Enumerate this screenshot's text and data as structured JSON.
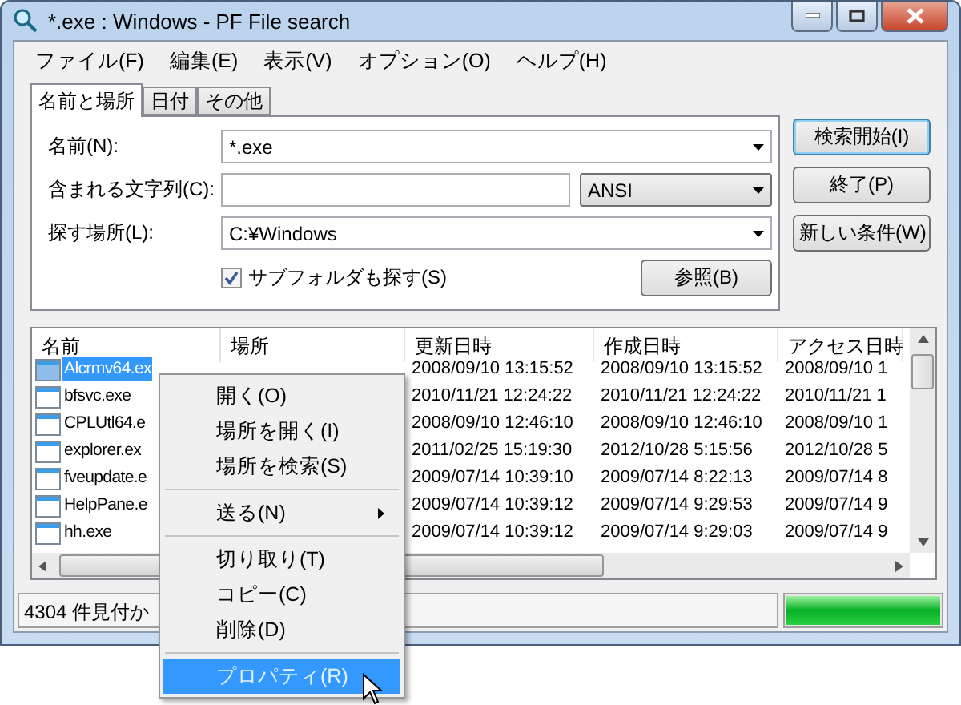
{
  "window": {
    "title": "*.exe : Windows - PF File search"
  },
  "menu": [
    "ファイル(F)",
    "編集(E)",
    "表示(V)",
    "オプション(O)",
    "ヘルプ(H)"
  ],
  "tabs": [
    {
      "label": "名前と場所",
      "selected": true
    },
    {
      "label": "日付",
      "selected": false
    },
    {
      "label": "その他",
      "selected": false
    }
  ],
  "form": {
    "name_label": "名前(N):",
    "name_value": "*.exe",
    "contains_label": "含まれる文字列(C):",
    "encoding": "ANSI",
    "location_label": "探す場所(L):",
    "location_value": "C:¥Windows",
    "subfolders": {
      "label": "サブフォルダも探す(S)",
      "checked": true
    },
    "browse_button": "参照(B)"
  },
  "buttons": [
    "検索開始(I)",
    "終了(P)",
    "新しい条件(W)"
  ],
  "table": {
    "columns": [
      "名前",
      "場所",
      "更新日時",
      "作成日時",
      "アクセス日時"
    ],
    "rows": [
      {
        "name": "Alcrmv64.ex",
        "selected": true,
        "updated": "2008/09/10 13:15:52",
        "created": "2008/09/10 13:15:52",
        "accessed": "2008/09/10 1"
      },
      {
        "name": "bfsvc.exe",
        "selected": false,
        "updated": "2010/11/21 12:24:22",
        "created": "2010/11/21 12:24:22",
        "accessed": "2010/11/21 1"
      },
      {
        "name": "CPLUtl64.e",
        "selected": false,
        "updated": "2008/09/10 12:46:10",
        "created": "2008/09/10 12:46:10",
        "accessed": "2008/09/10 1"
      },
      {
        "name": "explorer.ex",
        "selected": false,
        "updated": "2011/02/25 15:19:30",
        "created": "2012/10/28 5:15:56",
        "accessed": "2012/10/28 5"
      },
      {
        "name": "fveupdate.e",
        "selected": false,
        "updated": "2009/07/14 10:39:10",
        "created": "2009/07/14 8:22:13",
        "accessed": "2009/07/14 8"
      },
      {
        "name": "HelpPane.e",
        "selected": false,
        "updated": "2009/07/14 10:39:12",
        "created": "2009/07/14 9:29:53",
        "accessed": "2009/07/14 9"
      },
      {
        "name": "hh.exe",
        "selected": false,
        "updated": "2009/07/14 10:39:12",
        "created": "2009/07/14 9:29:03",
        "accessed": "2009/07/14 9"
      }
    ]
  },
  "status": {
    "text": "4304 件見付か",
    "progress": {
      "level": 1
    }
  },
  "context_menu": [
    {
      "kind": "item",
      "label": "開く(O)",
      "selected": false
    },
    {
      "kind": "item",
      "label": "場所を開く(I)",
      "selected": false
    },
    {
      "kind": "item",
      "label": "場所を検索(S)",
      "selected": false
    },
    {
      "kind": "separator"
    },
    {
      "kind": "submenu",
      "label": "送る(N)",
      "selected": false
    },
    {
      "kind": "separator"
    },
    {
      "kind": "item",
      "label": "切り取り(T)",
      "selected": false
    },
    {
      "kind": "item",
      "label": "コピー(C)",
      "selected": false
    },
    {
      "kind": "item",
      "label": "削除(D)",
      "selected": false
    },
    {
      "kind": "separator"
    },
    {
      "kind": "item",
      "label": "プロパティ(R)",
      "selected": true
    }
  ]
}
